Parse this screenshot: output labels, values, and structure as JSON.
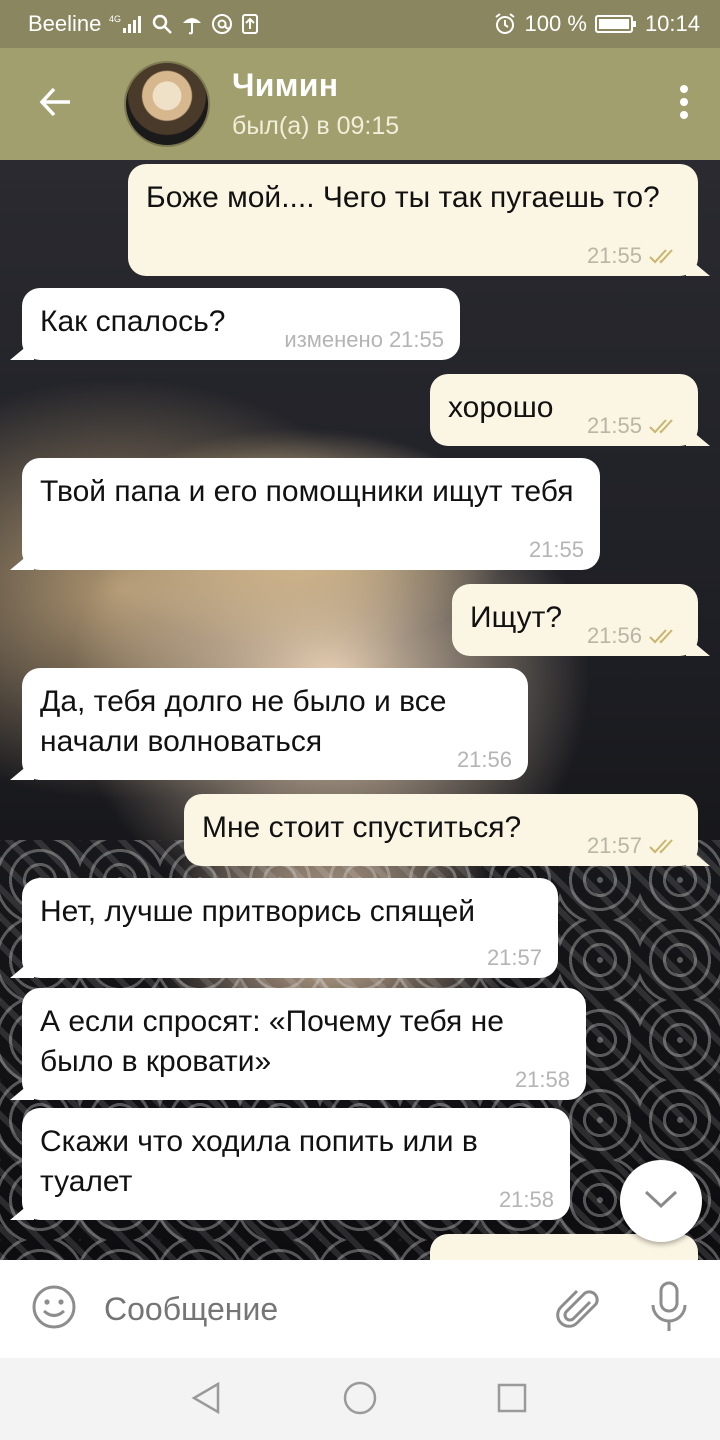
{
  "status_bar": {
    "carrier": "Beeline",
    "network": "4G",
    "battery": "100 %",
    "time": "10:14"
  },
  "header": {
    "name": "Чимин",
    "status": "был(а) в 09:15"
  },
  "messages": [
    {
      "dir": "out",
      "text": "Боже мой.... Чего ты так пугаешь то?",
      "time": "21:55",
      "read": true
    },
    {
      "dir": "in",
      "text": "Как спалось?",
      "edited": "изменено",
      "time": "21:55"
    },
    {
      "dir": "out",
      "text": "хорошо",
      "time": "21:55",
      "read": true
    },
    {
      "dir": "in",
      "text": "Твой папа и его помощники ищут тебя",
      "time": "21:55"
    },
    {
      "dir": "out",
      "text": "Ищут?",
      "time": "21:56",
      "read": true
    },
    {
      "dir": "in",
      "text": "Да, тебя долго не было и все начали волноваться",
      "time": "21:56"
    },
    {
      "dir": "out",
      "text": "Мне стоит спуститься?",
      "time": "21:57",
      "read": true
    },
    {
      "dir": "in",
      "text": "Нет, лучше притворись спящей",
      "time": "21:57"
    },
    {
      "dir": "in",
      "text": "А если спросят: «Почему тебя не было в кровати»",
      "time": "21:58"
    },
    {
      "dir": "in",
      "text": "Скажи что ходила попить или в туалет",
      "time": "21:58"
    }
  ],
  "composer": {
    "placeholder": "Сообщение"
  },
  "colors": {
    "header": "#a29f6e",
    "status_bar": "#8a8660",
    "outgoing_bubble": "#fbf5e3",
    "incoming_bubble": "#ffffff",
    "checkmark": "#c9b66e"
  },
  "icons": [
    "back-arrow-icon",
    "more-vert-icon",
    "double-check-icon",
    "chevron-down-icon",
    "emoji-icon",
    "attach-icon",
    "mic-icon",
    "nav-back-icon",
    "nav-home-icon",
    "nav-recents-icon"
  ]
}
